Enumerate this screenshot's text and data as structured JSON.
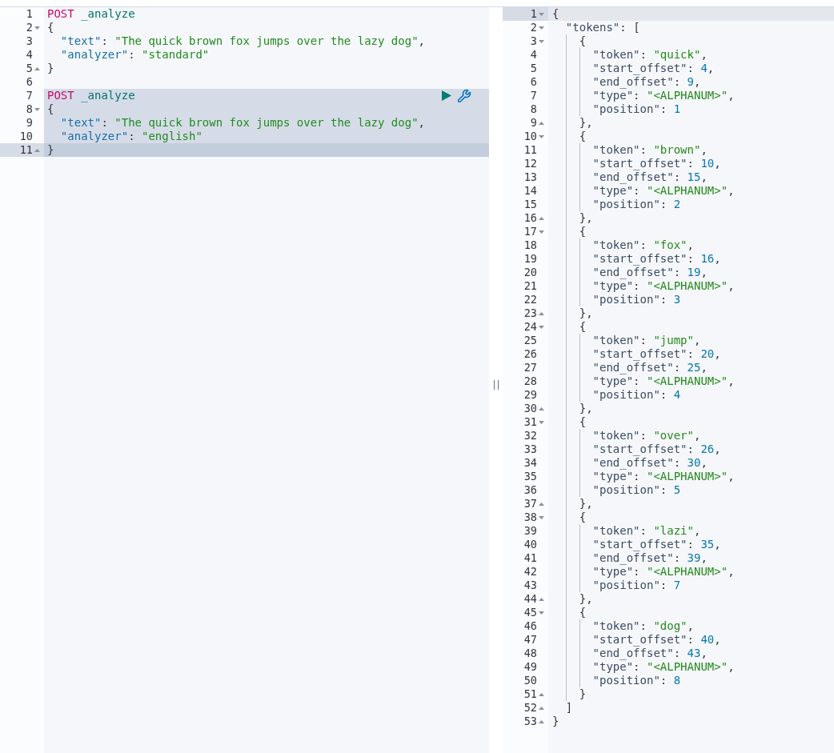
{
  "request_editor": {
    "lines": [
      {
        "n": "1",
        "kind": "plain",
        "selected": false,
        "active": false,
        "tokens": [
          {
            "kind": "method",
            "text": "POST"
          },
          {
            "kind": "path",
            "text": " _analyze"
          }
        ]
      },
      {
        "n": "2",
        "kind": "fold-start",
        "selected": false,
        "active": false,
        "tokens": [
          {
            "kind": "open",
            "text": "{"
          }
        ]
      },
      {
        "n": "3",
        "kind": "plain",
        "selected": false,
        "active": false,
        "tokens": [
          {
            "kind": "key",
            "text": "\"text\""
          },
          {
            "kind": "punct",
            "text": ": "
          },
          {
            "kind": "string",
            "text": "\"The quick brown fox jumps over the lazy dog\""
          },
          {
            "kind": "punct",
            "text": ","
          }
        ]
      },
      {
        "n": "4",
        "kind": "plain",
        "selected": false,
        "active": false,
        "tokens": [
          {
            "kind": "key",
            "text": "\"analyzer\""
          },
          {
            "kind": "punct",
            "text": ": "
          },
          {
            "kind": "string",
            "text": "\"standard\""
          }
        ]
      },
      {
        "n": "5",
        "kind": "fold-end",
        "selected": false,
        "active": false,
        "tokens": [
          {
            "kind": "close",
            "text": "}"
          }
        ]
      },
      {
        "n": "6",
        "kind": "plain",
        "selected": false,
        "active": false
      },
      {
        "n": "7",
        "kind": "plain",
        "selected": true,
        "active": false,
        "tokens": [
          {
            "kind": "method",
            "text": "POST"
          },
          {
            "kind": "path",
            "text": " _analyze"
          }
        ]
      },
      {
        "n": "8",
        "kind": "fold-start",
        "selected": true,
        "active": false,
        "tokens": [
          {
            "kind": "open",
            "text": "{"
          }
        ]
      },
      {
        "n": "9",
        "kind": "plain",
        "selected": true,
        "active": false,
        "tokens": [
          {
            "kind": "key",
            "text": "\"text\""
          },
          {
            "kind": "punct",
            "text": ": "
          },
          {
            "kind": "string",
            "text": "\"The quick brown fox jumps over the lazy dog\""
          },
          {
            "kind": "punct",
            "text": ","
          }
        ]
      },
      {
        "n": "10",
        "kind": "plain",
        "selected": true,
        "active": false,
        "tokens": [
          {
            "kind": "key",
            "text": "\"analyzer\""
          },
          {
            "kind": "punct",
            "text": ": "
          },
          {
            "kind": "string",
            "text": "\"english\""
          }
        ]
      },
      {
        "n": "11",
        "kind": "fold-end",
        "selected": true,
        "active": true,
        "tokens": [
          {
            "kind": "close",
            "text": "}"
          }
        ]
      }
    ]
  },
  "response_output": {
    "lines": [
      {
        "n": "1",
        "kind": "fold-start",
        "active": true,
        "tokens": [
          {
            "kind": "open",
            "text": "{"
          }
        ]
      },
      {
        "n": "2",
        "kind": "fold-start",
        "active": false,
        "tokens": [
          {
            "kind": "key",
            "text": "\"tokens\""
          },
          {
            "kind": "punct",
            "text": ": "
          },
          {
            "kind": "open",
            "text": "["
          }
        ]
      },
      {
        "n": "3",
        "kind": "fold-start",
        "active": false,
        "tokens": [
          {
            "kind": "open",
            "text": "{"
          }
        ]
      },
      {
        "n": "4",
        "kind": "plain",
        "active": false,
        "tokens": [
          {
            "kind": "key",
            "text": "\"token\""
          },
          {
            "kind": "punct",
            "text": ": "
          },
          {
            "kind": "string",
            "text": "\"quick\""
          },
          {
            "kind": "punct",
            "text": ","
          }
        ]
      },
      {
        "n": "5",
        "kind": "plain",
        "active": false,
        "tokens": [
          {
            "kind": "key",
            "text": "\"start_offset\""
          },
          {
            "kind": "punct",
            "text": ": "
          },
          {
            "kind": "number",
            "text": "4"
          },
          {
            "kind": "punct",
            "text": ","
          }
        ]
      },
      {
        "n": "6",
        "kind": "plain",
        "active": false,
        "tokens": [
          {
            "kind": "key",
            "text": "\"end_offset\""
          },
          {
            "kind": "punct",
            "text": ": "
          },
          {
            "kind": "number",
            "text": "9"
          },
          {
            "kind": "punct",
            "text": ","
          }
        ]
      },
      {
        "n": "7",
        "kind": "plain",
        "active": false,
        "tokens": [
          {
            "kind": "key",
            "text": "\"type\""
          },
          {
            "kind": "punct",
            "text": ": "
          },
          {
            "kind": "string",
            "text": "\"<ALPHANUM>\""
          },
          {
            "kind": "punct",
            "text": ","
          }
        ]
      },
      {
        "n": "8",
        "kind": "plain",
        "active": false,
        "tokens": [
          {
            "kind": "key",
            "text": "\"position\""
          },
          {
            "kind": "punct",
            "text": ": "
          },
          {
            "kind": "number",
            "text": "1"
          }
        ]
      },
      {
        "n": "9",
        "kind": "fold-end",
        "active": false,
        "tokens": [
          {
            "kind": "close",
            "text": "}"
          },
          {
            "kind": "punct",
            "text": ","
          }
        ]
      },
      {
        "n": "10",
        "kind": "fold-start",
        "active": false,
        "tokens": [
          {
            "kind": "open",
            "text": "{"
          }
        ]
      },
      {
        "n": "11",
        "kind": "plain",
        "active": false,
        "tokens": [
          {
            "kind": "key",
            "text": "\"token\""
          },
          {
            "kind": "punct",
            "text": ": "
          },
          {
            "kind": "string",
            "text": "\"brown\""
          },
          {
            "kind": "punct",
            "text": ","
          }
        ]
      },
      {
        "n": "12",
        "kind": "plain",
        "active": false,
        "tokens": [
          {
            "kind": "key",
            "text": "\"start_offset\""
          },
          {
            "kind": "punct",
            "text": ": "
          },
          {
            "kind": "number",
            "text": "10"
          },
          {
            "kind": "punct",
            "text": ","
          }
        ]
      },
      {
        "n": "13",
        "kind": "plain",
        "active": false,
        "tokens": [
          {
            "kind": "key",
            "text": "\"end_offset\""
          },
          {
            "kind": "punct",
            "text": ": "
          },
          {
            "kind": "number",
            "text": "15"
          },
          {
            "kind": "punct",
            "text": ","
          }
        ]
      },
      {
        "n": "14",
        "kind": "plain",
        "active": false,
        "tokens": [
          {
            "kind": "key",
            "text": "\"type\""
          },
          {
            "kind": "punct",
            "text": ": "
          },
          {
            "kind": "string",
            "text": "\"<ALPHANUM>\""
          },
          {
            "kind": "punct",
            "text": ","
          }
        ]
      },
      {
        "n": "15",
        "kind": "plain",
        "active": false,
        "tokens": [
          {
            "kind": "key",
            "text": "\"position\""
          },
          {
            "kind": "punct",
            "text": ": "
          },
          {
            "kind": "number",
            "text": "2"
          }
        ]
      },
      {
        "n": "16",
        "kind": "fold-end",
        "active": false,
        "tokens": [
          {
            "kind": "close",
            "text": "}"
          },
          {
            "kind": "punct",
            "text": ","
          }
        ]
      },
      {
        "n": "17",
        "kind": "fold-start",
        "active": false,
        "tokens": [
          {
            "kind": "open",
            "text": "{"
          }
        ]
      },
      {
        "n": "18",
        "kind": "plain",
        "active": false,
        "tokens": [
          {
            "kind": "key",
            "text": "\"token\""
          },
          {
            "kind": "punct",
            "text": ": "
          },
          {
            "kind": "string",
            "text": "\"fox\""
          },
          {
            "kind": "punct",
            "text": ","
          }
        ]
      },
      {
        "n": "19",
        "kind": "plain",
        "active": false,
        "tokens": [
          {
            "kind": "key",
            "text": "\"start_offset\""
          },
          {
            "kind": "punct",
            "text": ": "
          },
          {
            "kind": "number",
            "text": "16"
          },
          {
            "kind": "punct",
            "text": ","
          }
        ]
      },
      {
        "n": "20",
        "kind": "plain",
        "active": false,
        "tokens": [
          {
            "kind": "key",
            "text": "\"end_offset\""
          },
          {
            "kind": "punct",
            "text": ": "
          },
          {
            "kind": "number",
            "text": "19"
          },
          {
            "kind": "punct",
            "text": ","
          }
        ]
      },
      {
        "n": "21",
        "kind": "plain",
        "active": false,
        "tokens": [
          {
            "kind": "key",
            "text": "\"type\""
          },
          {
            "kind": "punct",
            "text": ": "
          },
          {
            "kind": "string",
            "text": "\"<ALPHANUM>\""
          },
          {
            "kind": "punct",
            "text": ","
          }
        ]
      },
      {
        "n": "22",
        "kind": "plain",
        "active": false,
        "tokens": [
          {
            "kind": "key",
            "text": "\"position\""
          },
          {
            "kind": "punct",
            "text": ": "
          },
          {
            "kind": "number",
            "text": "3"
          }
        ]
      },
      {
        "n": "23",
        "kind": "fold-end",
        "active": false,
        "tokens": [
          {
            "kind": "close",
            "text": "}"
          },
          {
            "kind": "punct",
            "text": ","
          }
        ]
      },
      {
        "n": "24",
        "kind": "fold-start",
        "active": false,
        "tokens": [
          {
            "kind": "open",
            "text": "{"
          }
        ]
      },
      {
        "n": "25",
        "kind": "plain",
        "active": false,
        "tokens": [
          {
            "kind": "key",
            "text": "\"token\""
          },
          {
            "kind": "punct",
            "text": ": "
          },
          {
            "kind": "string",
            "text": "\"jump\""
          },
          {
            "kind": "punct",
            "text": ","
          }
        ]
      },
      {
        "n": "26",
        "kind": "plain",
        "active": false,
        "tokens": [
          {
            "kind": "key",
            "text": "\"start_offset\""
          },
          {
            "kind": "punct",
            "text": ": "
          },
          {
            "kind": "number",
            "text": "20"
          },
          {
            "kind": "punct",
            "text": ","
          }
        ]
      },
      {
        "n": "27",
        "kind": "plain",
        "active": false,
        "tokens": [
          {
            "kind": "key",
            "text": "\"end_offset\""
          },
          {
            "kind": "punct",
            "text": ": "
          },
          {
            "kind": "number",
            "text": "25"
          },
          {
            "kind": "punct",
            "text": ","
          }
        ]
      },
      {
        "n": "28",
        "kind": "plain",
        "active": false,
        "tokens": [
          {
            "kind": "key",
            "text": "\"type\""
          },
          {
            "kind": "punct",
            "text": ": "
          },
          {
            "kind": "string",
            "text": "\"<ALPHANUM>\""
          },
          {
            "kind": "punct",
            "text": ","
          }
        ]
      },
      {
        "n": "29",
        "kind": "plain",
        "active": false,
        "tokens": [
          {
            "kind": "key",
            "text": "\"position\""
          },
          {
            "kind": "punct",
            "text": ": "
          },
          {
            "kind": "number",
            "text": "4"
          }
        ]
      },
      {
        "n": "30",
        "kind": "fold-end",
        "active": false,
        "tokens": [
          {
            "kind": "close",
            "text": "}"
          },
          {
            "kind": "punct",
            "text": ","
          }
        ]
      },
      {
        "n": "31",
        "kind": "fold-start",
        "active": false,
        "tokens": [
          {
            "kind": "open",
            "text": "{"
          }
        ]
      },
      {
        "n": "32",
        "kind": "plain",
        "active": false,
        "tokens": [
          {
            "kind": "key",
            "text": "\"token\""
          },
          {
            "kind": "punct",
            "text": ": "
          },
          {
            "kind": "string",
            "text": "\"over\""
          },
          {
            "kind": "punct",
            "text": ","
          }
        ]
      },
      {
        "n": "33",
        "kind": "plain",
        "active": false,
        "tokens": [
          {
            "kind": "key",
            "text": "\"start_offset\""
          },
          {
            "kind": "punct",
            "text": ": "
          },
          {
            "kind": "number",
            "text": "26"
          },
          {
            "kind": "punct",
            "text": ","
          }
        ]
      },
      {
        "n": "34",
        "kind": "plain",
        "active": false,
        "tokens": [
          {
            "kind": "key",
            "text": "\"end_offset\""
          },
          {
            "kind": "punct",
            "text": ": "
          },
          {
            "kind": "number",
            "text": "30"
          },
          {
            "kind": "punct",
            "text": ","
          }
        ]
      },
      {
        "n": "35",
        "kind": "plain",
        "active": false,
        "tokens": [
          {
            "kind": "key",
            "text": "\"type\""
          },
          {
            "kind": "punct",
            "text": ": "
          },
          {
            "kind": "string",
            "text": "\"<ALPHANUM>\""
          },
          {
            "kind": "punct",
            "text": ","
          }
        ]
      },
      {
        "n": "36",
        "kind": "plain",
        "active": false,
        "tokens": [
          {
            "kind": "key",
            "text": "\"position\""
          },
          {
            "kind": "punct",
            "text": ": "
          },
          {
            "kind": "number",
            "text": "5"
          }
        ]
      },
      {
        "n": "37",
        "kind": "fold-end",
        "active": false,
        "tokens": [
          {
            "kind": "close",
            "text": "}"
          },
          {
            "kind": "punct",
            "text": ","
          }
        ]
      },
      {
        "n": "38",
        "kind": "fold-start",
        "active": false,
        "tokens": [
          {
            "kind": "open",
            "text": "{"
          }
        ]
      },
      {
        "n": "39",
        "kind": "plain",
        "active": false,
        "tokens": [
          {
            "kind": "key",
            "text": "\"token\""
          },
          {
            "kind": "punct",
            "text": ": "
          },
          {
            "kind": "string",
            "text": "\"lazi\""
          },
          {
            "kind": "punct",
            "text": ","
          }
        ]
      },
      {
        "n": "40",
        "kind": "plain",
        "active": false,
        "tokens": [
          {
            "kind": "key",
            "text": "\"start_offset\""
          },
          {
            "kind": "punct",
            "text": ": "
          },
          {
            "kind": "number",
            "text": "35"
          },
          {
            "kind": "punct",
            "text": ","
          }
        ]
      },
      {
        "n": "41",
        "kind": "plain",
        "active": false,
        "tokens": [
          {
            "kind": "key",
            "text": "\"end_offset\""
          },
          {
            "kind": "punct",
            "text": ": "
          },
          {
            "kind": "number",
            "text": "39"
          },
          {
            "kind": "punct",
            "text": ","
          }
        ]
      },
      {
        "n": "42",
        "kind": "plain",
        "active": false,
        "tokens": [
          {
            "kind": "key",
            "text": "\"type\""
          },
          {
            "kind": "punct",
            "text": ": "
          },
          {
            "kind": "string",
            "text": "\"<ALPHANUM>\""
          },
          {
            "kind": "punct",
            "text": ","
          }
        ]
      },
      {
        "n": "43",
        "kind": "plain",
        "active": false,
        "tokens": [
          {
            "kind": "key",
            "text": "\"position\""
          },
          {
            "kind": "punct",
            "text": ": "
          },
          {
            "kind": "number",
            "text": "7"
          }
        ]
      },
      {
        "n": "44",
        "kind": "fold-end",
        "active": false,
        "tokens": [
          {
            "kind": "close",
            "text": "}"
          },
          {
            "kind": "punct",
            "text": ","
          }
        ]
      },
      {
        "n": "45",
        "kind": "fold-start",
        "active": false,
        "tokens": [
          {
            "kind": "open",
            "text": "{"
          }
        ]
      },
      {
        "n": "46",
        "kind": "plain",
        "active": false,
        "tokens": [
          {
            "kind": "key",
            "text": "\"token\""
          },
          {
            "kind": "punct",
            "text": ": "
          },
          {
            "kind": "string",
            "text": "\"dog\""
          },
          {
            "kind": "punct",
            "text": ","
          }
        ]
      },
      {
        "n": "47",
        "kind": "plain",
        "active": false,
        "tokens": [
          {
            "kind": "key",
            "text": "\"start_offset\""
          },
          {
            "kind": "punct",
            "text": ": "
          },
          {
            "kind": "number",
            "text": "40"
          },
          {
            "kind": "punct",
            "text": ","
          }
        ]
      },
      {
        "n": "48",
        "kind": "plain",
        "active": false,
        "tokens": [
          {
            "kind": "key",
            "text": "\"end_offset\""
          },
          {
            "kind": "punct",
            "text": ": "
          },
          {
            "kind": "number",
            "text": "43"
          },
          {
            "kind": "punct",
            "text": ","
          }
        ]
      },
      {
        "n": "49",
        "kind": "plain",
        "active": false,
        "tokens": [
          {
            "kind": "key",
            "text": "\"type\""
          },
          {
            "kind": "punct",
            "text": ": "
          },
          {
            "kind": "string",
            "text": "\"<ALPHANUM>\""
          },
          {
            "kind": "punct",
            "text": ","
          }
        ]
      },
      {
        "n": "50",
        "kind": "plain",
        "active": false,
        "tokens": [
          {
            "kind": "key",
            "text": "\"position\""
          },
          {
            "kind": "punct",
            "text": ": "
          },
          {
            "kind": "number",
            "text": "8"
          }
        ]
      },
      {
        "n": "51",
        "kind": "fold-end",
        "active": false,
        "tokens": [
          {
            "kind": "close",
            "text": "}"
          }
        ]
      },
      {
        "n": "52",
        "kind": "fold-end",
        "active": false,
        "tokens": [
          {
            "kind": "close",
            "text": "]"
          }
        ]
      },
      {
        "n": "53",
        "kind": "fold-end",
        "active": false,
        "tokens": [
          {
            "kind": "close",
            "text": "}"
          }
        ]
      }
    ]
  }
}
